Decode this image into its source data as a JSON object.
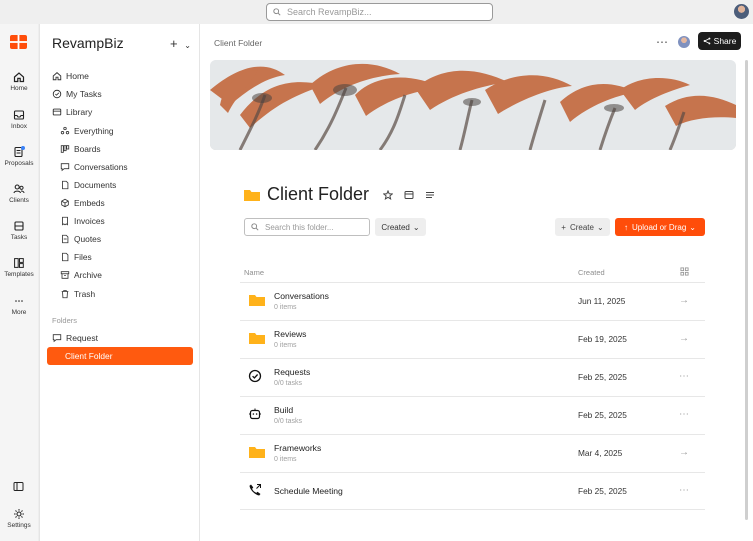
{
  "search": {
    "placeholder": "Search RevampBiz..."
  },
  "rail": {
    "items": [
      {
        "label": "Home",
        "icon": "home-icon"
      },
      {
        "label": "Inbox",
        "icon": "inbox-icon"
      },
      {
        "label": "Proposals",
        "icon": "proposals-icon"
      },
      {
        "label": "Clients",
        "icon": "clients-icon"
      },
      {
        "label": "Tasks",
        "icon": "tasks-icon"
      },
      {
        "label": "Templates",
        "icon": "templates-icon"
      },
      {
        "label": "More",
        "icon": "more-icon"
      }
    ],
    "settings_label": "Settings"
  },
  "sidebar": {
    "brand": "RevampBiz",
    "nav": [
      "Home",
      "My Tasks",
      "Library"
    ],
    "library_items": [
      "Everything",
      "Boards",
      "Conversations",
      "Documents",
      "Embeds",
      "Invoices",
      "Quotes",
      "Files",
      "Archive",
      "Trash"
    ],
    "folders_label": "Folders",
    "folders": [
      "Request",
      "Client Folder"
    ]
  },
  "header": {
    "breadcrumb": "Client Folder",
    "share_label": "Share"
  },
  "folder": {
    "title": "Client Folder",
    "search_placeholder": "Search this folder...",
    "sort_label": "Created",
    "create_label": "Create",
    "upload_label": "Upload or Drag",
    "columns": {
      "name": "Name",
      "created": "Created"
    }
  },
  "rows": [
    {
      "name": "Conversations",
      "meta": "0 items",
      "date": "Jun 11, 2025",
      "icon": "folder-icon",
      "action": "arrow-right-icon"
    },
    {
      "name": "Reviews",
      "meta": "0 items",
      "date": "Feb 19, 2025",
      "icon": "folder-icon",
      "action": "arrow-right-icon"
    },
    {
      "name": "Requests",
      "meta": "0/0 tasks",
      "date": "Feb 25, 2025",
      "icon": "check-circle-icon",
      "action": "more-icon"
    },
    {
      "name": "Build",
      "meta": "0/0 tasks",
      "date": "Feb 25, 2025",
      "icon": "robot-icon",
      "action": "more-icon"
    },
    {
      "name": "Frameworks",
      "meta": "0 items",
      "date": "Mar 4, 2025",
      "icon": "folder-icon",
      "action": "arrow-right-icon"
    },
    {
      "name": "Schedule Meeting",
      "meta": "",
      "date": "Feb 25, 2025",
      "icon": "phone-icon",
      "action": "more-icon"
    }
  ],
  "colors": {
    "accent": "#ff4d0a",
    "folder": "#ffb21a"
  }
}
